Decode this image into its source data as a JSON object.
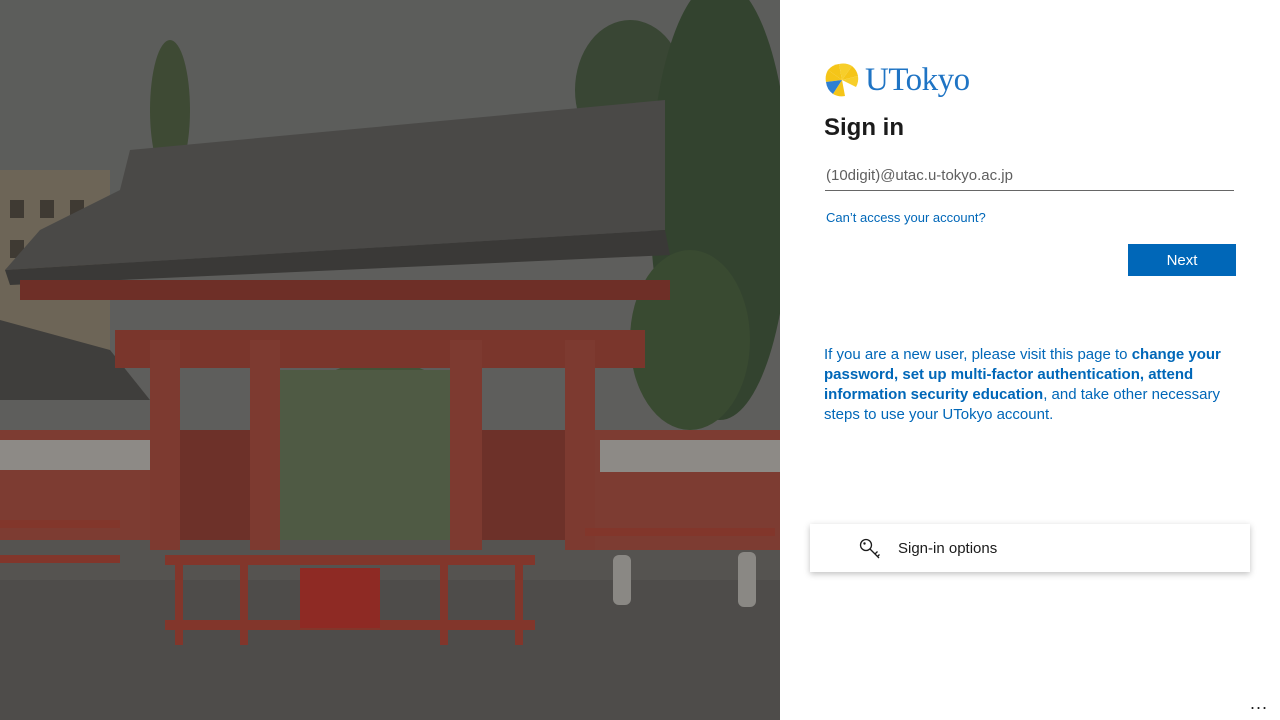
{
  "background": {
    "alt": "University of Tokyo Akamon gate",
    "accent": "#8a3b30"
  },
  "brand": {
    "name": "UTokyo",
    "color": "#1f74c4",
    "icon": "ginkgo-leaf-icon"
  },
  "signin": {
    "title": "Sign in",
    "email_placeholder": "(10digit)@utac.u-tokyo.ac.jp",
    "cant_access": "Can’t access your account?",
    "next_label": "Next",
    "accent_color": "#0067b8"
  },
  "info": {
    "part1": "If you are a new user, please visit this page to ",
    "bold": "change your password, set up multi-factor authentication, attend information security education",
    "part2": ", and take other necessary steps to use your UTokyo account."
  },
  "options": {
    "label": "Sign-in options",
    "icon": "key-icon"
  },
  "footer": {
    "more_label": "..."
  }
}
